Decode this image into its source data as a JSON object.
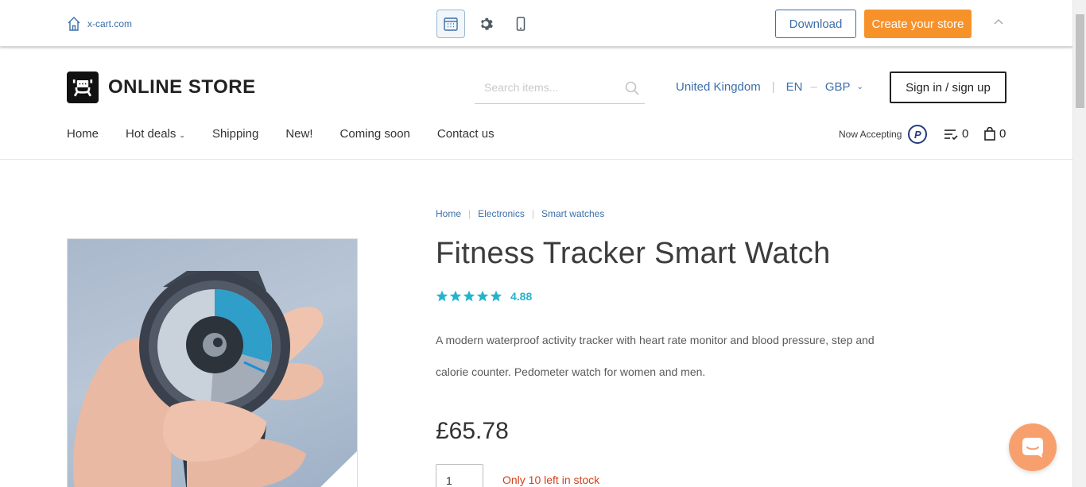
{
  "demo_bar": {
    "site_link": "x-cart.com",
    "tools": [
      "calendar-icon",
      "gear-icon",
      "mobile-icon"
    ],
    "download_label": "Download",
    "create_store_label": "Create your store",
    "colors": {
      "accent": "#3d6fa8",
      "create": "#f7922b"
    }
  },
  "header": {
    "logo_text": "ONLINE STORE",
    "search_placeholder": "Search items...",
    "country": "United Kingdom",
    "language": "EN",
    "currency": "GBP",
    "signin_label": "Sign in / sign up",
    "nav": [
      {
        "label": "Home"
      },
      {
        "label": "Hot deals"
      },
      {
        "label": "Shipping"
      },
      {
        "label": "New!"
      },
      {
        "label": "Coming soon"
      },
      {
        "label": "Contact us"
      }
    ],
    "paypal_text": "Now Accepting",
    "compare_count": "0",
    "cart_count": "0"
  },
  "product": {
    "breadcrumb": [
      "Home",
      "Electronics",
      "Smart watches"
    ],
    "title": "Fitness Tracker Smart Watch",
    "rating_stars": 5,
    "rating_value": "4.88",
    "description": "A modern waterproof activity tracker with heart rate monitor and blood pressure, step and calorie counter. Pedometer watch for women and men.",
    "price": "£65.78",
    "quantity": "1",
    "stock_text": "Only 10 left in stock",
    "colors": {
      "rating": "#26b3cc",
      "stock": "#d2421b"
    }
  }
}
